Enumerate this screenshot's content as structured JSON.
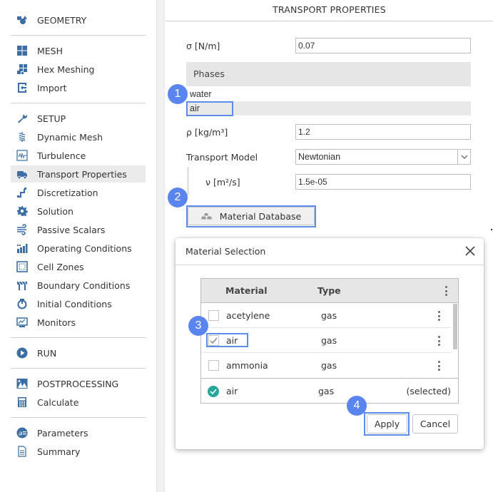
{
  "sidebar": {
    "items": [
      {
        "label": "GEOMETRY",
        "icon": "geometry-icon"
      },
      {
        "label": "MESH",
        "icon": "mesh-icon"
      },
      {
        "label": "Hex Meshing",
        "icon": "hex-meshing-icon"
      },
      {
        "label": "Import",
        "icon": "import-icon"
      },
      {
        "label": "SETUP",
        "icon": "wrench-icon"
      },
      {
        "label": "Dynamic Mesh",
        "icon": "spring-icon"
      },
      {
        "label": "Turbulence",
        "icon": "waveform-icon"
      },
      {
        "label": "Transport Properties",
        "icon": "truck-icon",
        "active": true
      },
      {
        "label": "Discretization",
        "icon": "discretization-icon"
      },
      {
        "label": "Solution",
        "icon": "gear-icon"
      },
      {
        "label": "Passive Scalars",
        "icon": "wind-icon"
      },
      {
        "label": "Operating Conditions",
        "icon": "bar-chart-icon"
      },
      {
        "label": "Cell Zones",
        "icon": "cell-zones-icon"
      },
      {
        "label": "Boundary Conditions",
        "icon": "barrier-icon"
      },
      {
        "label": "Initial Conditions",
        "icon": "power-icon"
      },
      {
        "label": "Monitors",
        "icon": "monitor-icon"
      },
      {
        "label": "RUN",
        "icon": "play-icon"
      },
      {
        "label": "POSTPROCESSING",
        "icon": "image-icon"
      },
      {
        "label": "Calculate",
        "icon": "calculator-icon"
      },
      {
        "label": "Parameters",
        "icon": "parameters-icon"
      },
      {
        "label": "Summary",
        "icon": "document-icon"
      }
    ]
  },
  "panel": {
    "title": "TRANSPORT PROPERTIES",
    "sigma_label": "σ [N/m]",
    "sigma_value": "0.07",
    "phases_header": "Phases",
    "phases": [
      "water",
      "air"
    ],
    "selected_phase": "air",
    "rho_label": "ρ [kg/m³]",
    "rho_value": "1.2",
    "transport_model_label": "Transport Model",
    "transport_model_value": "Newtonian",
    "nu_label": "ν [m²/s]",
    "nu_value": "1.5e-05",
    "material_db_button": "Material Database"
  },
  "dialog": {
    "title": "Material Selection",
    "columns": [
      "Material",
      "Type"
    ],
    "rows": [
      {
        "material": "acetylene",
        "type": "gas",
        "checked": false
      },
      {
        "material": "air",
        "type": "gas",
        "checked": true
      },
      {
        "material": "ammonia",
        "type": "gas",
        "checked": false
      }
    ],
    "footer": {
      "material": "air",
      "type": "gas",
      "note": "(selected)"
    },
    "apply_label": "Apply",
    "cancel_label": "Cancel"
  },
  "steps": [
    "1",
    "2",
    "3",
    "4"
  ],
  "colors": {
    "accent": "#3a6ea5",
    "highlight": "#5b8def",
    "badge": "#5b85ee",
    "selected_check": "#26a69a"
  }
}
